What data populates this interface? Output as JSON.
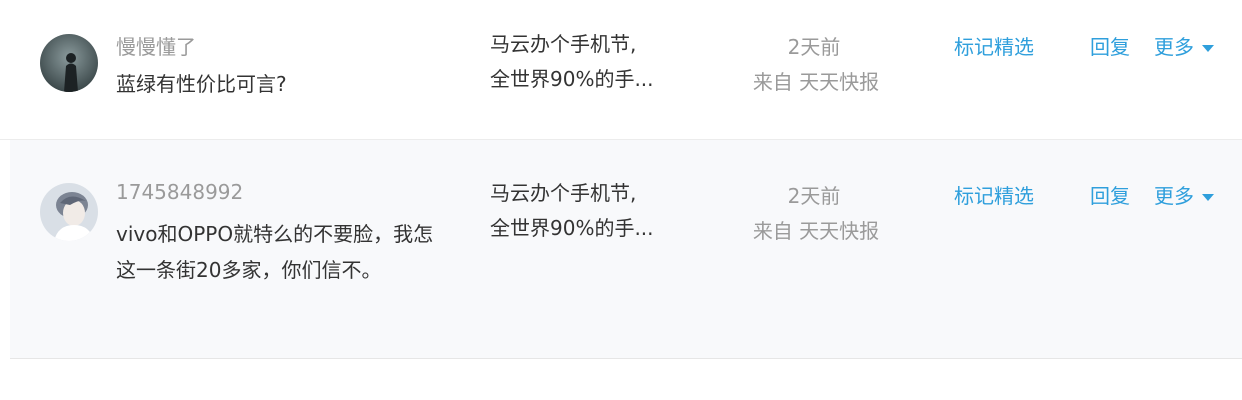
{
  "colors": {
    "link": "#2f9fdc",
    "muted": "#9a9a9a",
    "text": "#333333",
    "row_alt_bg": "#f8f9fb"
  },
  "comments": [
    {
      "username": "慢慢懂了",
      "text": "蓝绿有性价比可言?",
      "article_line1": "马云办个手机节,",
      "article_line2": "全世界90%的手...",
      "time": "2天前",
      "source": "来自 天天快报",
      "mark_label": "标记精选",
      "reply_label": "回复",
      "more_label": "更多",
      "more_icon": "caret-down-icon",
      "avatar_icon": "user-avatar"
    },
    {
      "username": "1745848992",
      "text": "vivo和OPPO就特么的不要脸，我怎这一条街20多家，你们信不。",
      "article_line1": "马云办个手机节,",
      "article_line2": "全世界90%的手...",
      "time": "2天前",
      "source": "来自 天天快报",
      "mark_label": "标记精选",
      "reply_label": "回复",
      "more_label": "更多",
      "more_icon": "caret-down-icon",
      "avatar_icon": "user-avatar"
    }
  ]
}
